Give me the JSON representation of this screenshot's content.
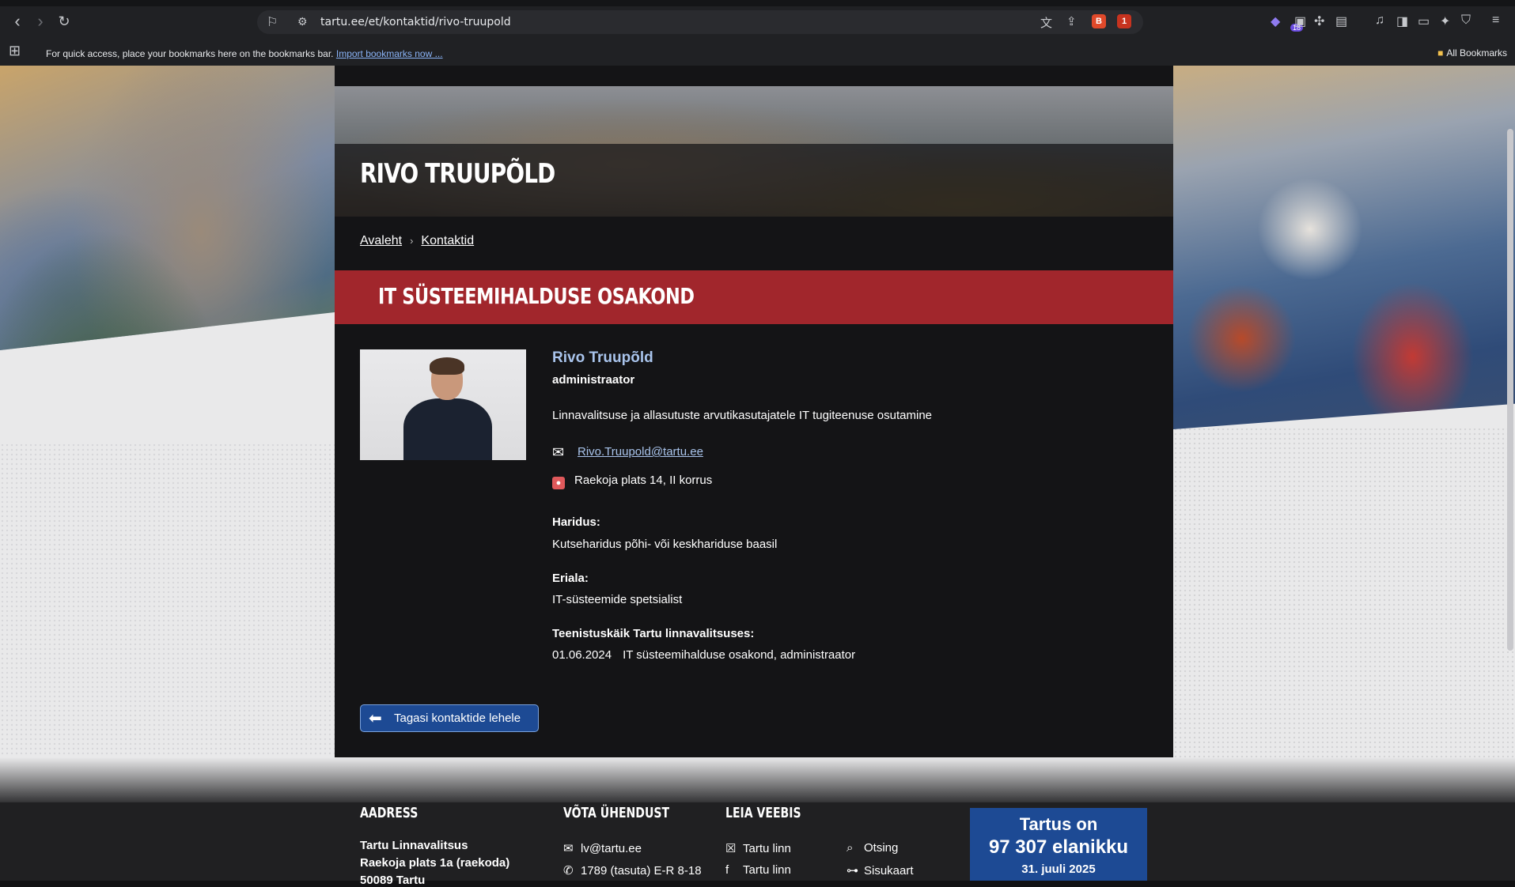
{
  "browser": {
    "url": "tartu.ee/et/kontaktid/rivo-truupold",
    "shield_count": "1",
    "bookmarks_hint": "For quick access, place your bookmarks here on the bookmarks bar.",
    "bookmarks_import": "Import bookmarks now ...",
    "all_bookmarks": "All Bookmarks",
    "ext_badge": "18"
  },
  "page": {
    "title": "RIVO TRUUPÕLD",
    "breadcrumb": [
      "Avaleht",
      "Kontaktid"
    ],
    "department": "IT SÜSTEEMIHALDUSE OSAKOND"
  },
  "person": {
    "name": "Rivo Truupõld",
    "role": "administraator",
    "description": "Linnavalitsuse ja allasutuste arvutikasutajatele IT tugiteenuse osutamine",
    "email": "Rivo.Truupold@tartu.ee",
    "address": "Raekoja plats 14, II korrus",
    "education_label": "Haridus:",
    "education_value": "Kutseharidus põhi- või keskhariduse baasil",
    "specialty_label": "Eriala:",
    "specialty_value": "IT-süsteemide spetsialist",
    "service_label": "Teenistuskäik Tartu linnavalitsuses:",
    "service_date": "01.06.2024",
    "service_value": "IT süsteemihalduse osakond, administraator"
  },
  "back_button": "Tagasi kontaktide lehele",
  "footer": {
    "address_head": "AADRESS",
    "address_org": "Tartu Linnavalitsus",
    "address_line": "Raekoja plats 1a (raekoda)",
    "address_zip": "50089 Tartu",
    "contact_head": "VÕTA ÜHENDUST",
    "contact_email": "lv@tartu.ee",
    "contact_phone": "1789 (tasuta) E-R 8-18",
    "web_head": "LEIA VEEBIS",
    "web_x": "Tartu linn",
    "web_fb": "Tartu linn",
    "search": "Otsing",
    "sitemap": "Sisukaart",
    "pop_l1": "Tartus on",
    "pop_l2": "97 307 elanikku",
    "pop_l3": "31. juuli 2025"
  }
}
